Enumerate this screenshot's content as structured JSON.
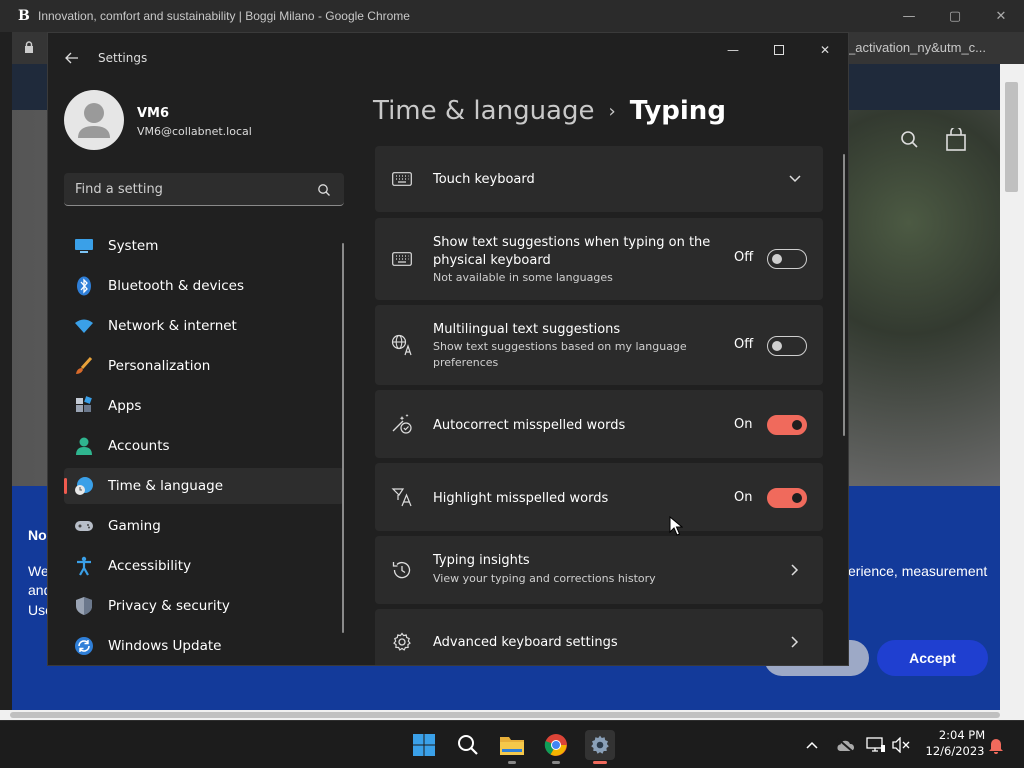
{
  "chrome": {
    "title": "Innovation, comfort and sustainability | Boggi Milano - Google Chrome",
    "logo": "B",
    "address_tail": "_activation_ny&utm_c...",
    "banner_partial_1": "No",
    "banner_partial_2": "We",
    "banner_partial_3": "and",
    "banner_partial_4": "Use",
    "banner_right_text": "erience, measurement",
    "hero_letter": ")",
    "accept_label": "Accept"
  },
  "settings": {
    "app_title": "Settings",
    "user": {
      "name": "VM6",
      "email": "VM6@collabnet.local"
    },
    "search": {
      "placeholder": "Find a setting"
    },
    "nav": [
      {
        "label": "System",
        "icon": "system-icon"
      },
      {
        "label": "Bluetooth & devices",
        "icon": "bluetooth-icon"
      },
      {
        "label": "Network & internet",
        "icon": "network-icon"
      },
      {
        "label": "Personalization",
        "icon": "brush-icon"
      },
      {
        "label": "Apps",
        "icon": "apps-icon"
      },
      {
        "label": "Accounts",
        "icon": "accounts-icon"
      },
      {
        "label": "Time & language",
        "icon": "time-language-icon",
        "active": true
      },
      {
        "label": "Gaming",
        "icon": "gamepad-icon"
      },
      {
        "label": "Accessibility",
        "icon": "accessibility-icon"
      },
      {
        "label": "Privacy & security",
        "icon": "shield-icon"
      },
      {
        "label": "Windows Update",
        "icon": "update-icon"
      }
    ],
    "breadcrumb": {
      "parent": "Time & language",
      "separator": "›",
      "current": "Typing"
    },
    "cards": {
      "touch_keyboard": {
        "title": "Touch keyboard"
      },
      "text_suggestions": {
        "title_line1": "Show text suggestions when typing on the",
        "title_line2": "physical keyboard",
        "subtitle": "Not available in some languages",
        "state": "Off"
      },
      "multilingual": {
        "title": "Multilingual text suggestions",
        "subtitle_line1": "Show text suggestions based on my language",
        "subtitle_line2": "preferences",
        "state": "Off"
      },
      "autocorrect": {
        "title": "Autocorrect misspelled words",
        "state": "On"
      },
      "highlight": {
        "title": "Highlight misspelled words",
        "state": "On"
      },
      "insights": {
        "title": "Typing insights",
        "subtitle": "View your typing and corrections history"
      },
      "advanced": {
        "title": "Advanced keyboard settings"
      }
    }
  },
  "taskbar": {
    "time": "2:04 PM",
    "date": "12/6/2023"
  },
  "colors": {
    "accent": "#f06a5c",
    "settings_bg": "#202020",
    "card_bg": "#2b2b2b",
    "banner_blue": "#133a9a",
    "accept_blue": "#1f3fd0"
  }
}
